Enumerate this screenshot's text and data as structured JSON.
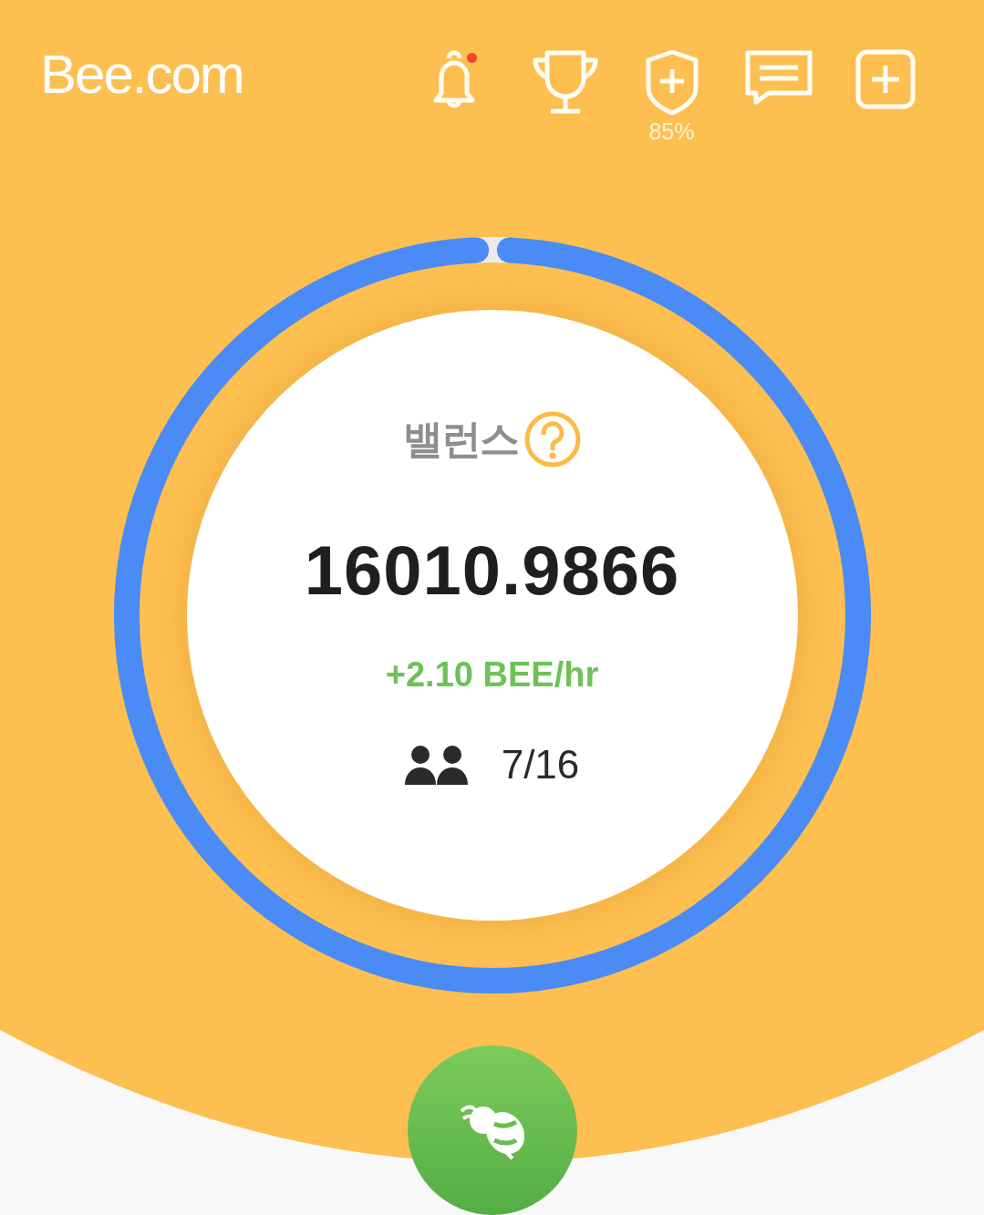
{
  "header": {
    "logo": "Bee.com",
    "actions": [
      {
        "kind": "bell",
        "badge": true
      },
      {
        "kind": "trophy"
      },
      {
        "kind": "shield",
        "caption": "85%"
      },
      {
        "kind": "chat"
      },
      {
        "kind": "add"
      }
    ]
  },
  "balance": {
    "label": "밸런스",
    "value": "16010.9866",
    "rate": "+2.10 BEE/hr",
    "team": "7/16",
    "ring": {
      "level": 0.985
    }
  },
  "mine_button": {
    "kind": "bee"
  }
}
